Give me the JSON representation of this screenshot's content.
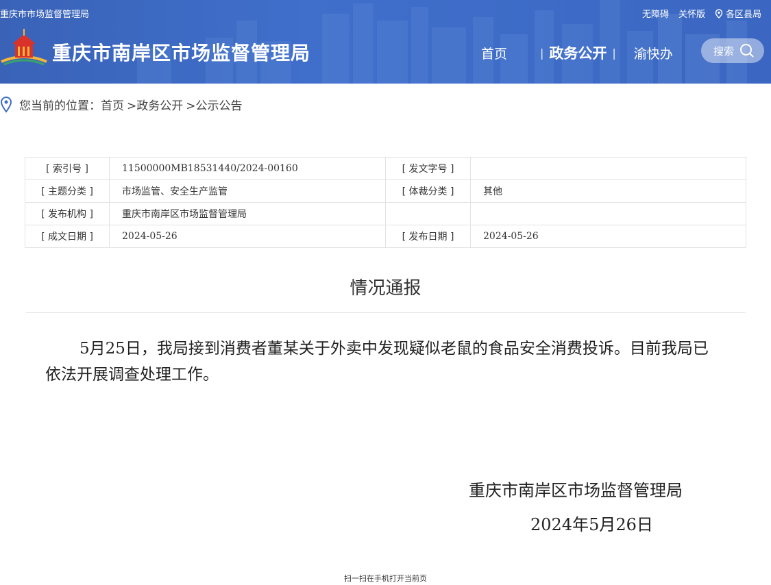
{
  "header": {
    "site_name_small": "重庆市市场监督管理局",
    "links": {
      "accessible": "无障碍",
      "care": "关怀版",
      "districts": "各区县局"
    },
    "site_title": "重庆市南岸区市场监督管理局",
    "nav": [
      {
        "label": "首页",
        "active": false
      },
      {
        "label": "政务公开",
        "active": true
      },
      {
        "label": "渝快办",
        "active": false
      }
    ],
    "search_label": "搜索"
  },
  "breadcrumb": {
    "prefix": "您当前的位置：",
    "items": [
      "首页",
      ">政务公开",
      ">公示公告"
    ]
  },
  "meta": {
    "index_label": "[ 索引号 ]",
    "index_value": "11500000MB18531440/2024-00160",
    "doc_no_label": "[ 发文字号 ]",
    "doc_no_value": "",
    "topic_label": "[ 主题分类 ]",
    "topic_value": "市场监管、安全生产监管",
    "genre_label": "[ 体裁分类 ]",
    "genre_value": "其他",
    "org_label": "[ 发布机构 ]",
    "org_value": "重庆市南岸区市场监督管理局",
    "created_label": "[ 成文日期 ]",
    "created_value": "2024-05-26",
    "published_label": "[ 发布日期 ]",
    "published_value": "2024-05-26"
  },
  "article": {
    "title": "情况通报",
    "body": "5月25日，我局接到消费者董某关于外卖中发现疑似老鼠的食品安全消费投诉。目前我局已依法开展调查处理工作。",
    "signature_org": "重庆市南岸区市场监督管理局",
    "signature_date": "2024年5月26日"
  },
  "footer": {
    "qr_tip": "扫一扫在手机打开当前页"
  },
  "colors": {
    "banner": "#3f6fcb",
    "accent_logo_red": "#d8322b",
    "accent_logo_gold": "#f4b63a"
  }
}
